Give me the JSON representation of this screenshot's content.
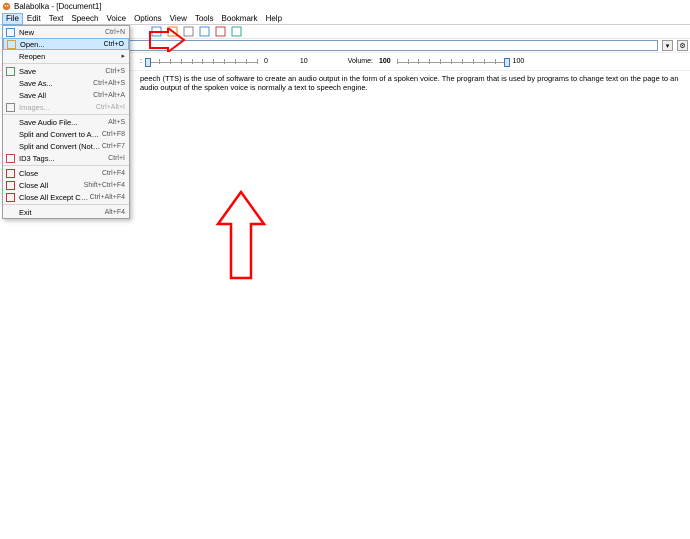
{
  "app": {
    "icon": "balabolka",
    "title": "Balabolka - [Document1]"
  },
  "menubar": [
    "File",
    "Edit",
    "Text",
    "Speech",
    "Voice",
    "Options",
    "View",
    "Tools",
    "Bookmark",
    "Help"
  ],
  "menubar_active_index": 0,
  "toolbar_icons": [
    "doc-icon",
    "book-icon",
    "split-icon",
    "sheet-icon",
    "tag-icon",
    "question-icon"
  ],
  "voicebar": {
    "dropdown_arrow": "▾",
    "settings_btn": "⚙"
  },
  "sliders": {
    "left_label": ":",
    "left_min": "0",
    "left_max": "10",
    "left_pos_pct": 0,
    "right_label": "Volume:",
    "right_value": "100",
    "right_min": "0",
    "right_max": "100",
    "right_pos_pct": 100
  },
  "doc_text": "peech (TTS) is the use of software to create an audio output in the form of a spoken voice. The program that is used by programs to change text on the page to an audio output of the spoken voice is normally a text to speech engine.",
  "file_menu": [
    {
      "icon": "new-icon",
      "label": "New",
      "shortcut": "Ctrl+N"
    },
    {
      "icon": "open-icon",
      "label": "Open...",
      "shortcut": "Ctrl+O",
      "highlight": true
    },
    {
      "icon": "",
      "label": "Reopen",
      "submenu": true
    },
    {
      "sep": true
    },
    {
      "icon": "save-icon",
      "label": "Save",
      "shortcut": "Ctrl+S"
    },
    {
      "icon": "",
      "label": "Save As...",
      "shortcut": "Ctrl+Alt+S"
    },
    {
      "icon": "",
      "label": "Save All",
      "shortcut": "Ctrl+Alt+A"
    },
    {
      "icon": "image-icon",
      "label": "Images...",
      "shortcut": "Ctrl+Alt+I",
      "disabled": true
    },
    {
      "sep": true
    },
    {
      "icon": "",
      "label": "Save Audio File...",
      "shortcut": "Alt+S"
    },
    {
      "icon": "",
      "label": "Split and Convert to Audio Files...",
      "shortcut": "Ctrl+F8"
    },
    {
      "icon": "",
      "label": "Split and Convert (Not Show Window)",
      "shortcut": "Ctrl+F7"
    },
    {
      "icon": "tag-icon",
      "label": "ID3 Tags...",
      "shortcut": "Ctrl+I"
    },
    {
      "sep": true
    },
    {
      "icon": "close-icon",
      "label": "Close",
      "shortcut": "Ctrl+F4"
    },
    {
      "icon": "close-all-icon",
      "label": "Close All",
      "shortcut": "Shift+Ctrl+F4"
    },
    {
      "icon": "close-all-icon",
      "label": "Close All Except Current",
      "shortcut": "Ctrl+Alt+F4"
    },
    {
      "sep": true
    },
    {
      "icon": "",
      "label": "Exit",
      "shortcut": "Alt+F4"
    }
  ],
  "annotations": {
    "arrow1": "red-arrow-right",
    "arrow2": "red-arrow-up"
  }
}
